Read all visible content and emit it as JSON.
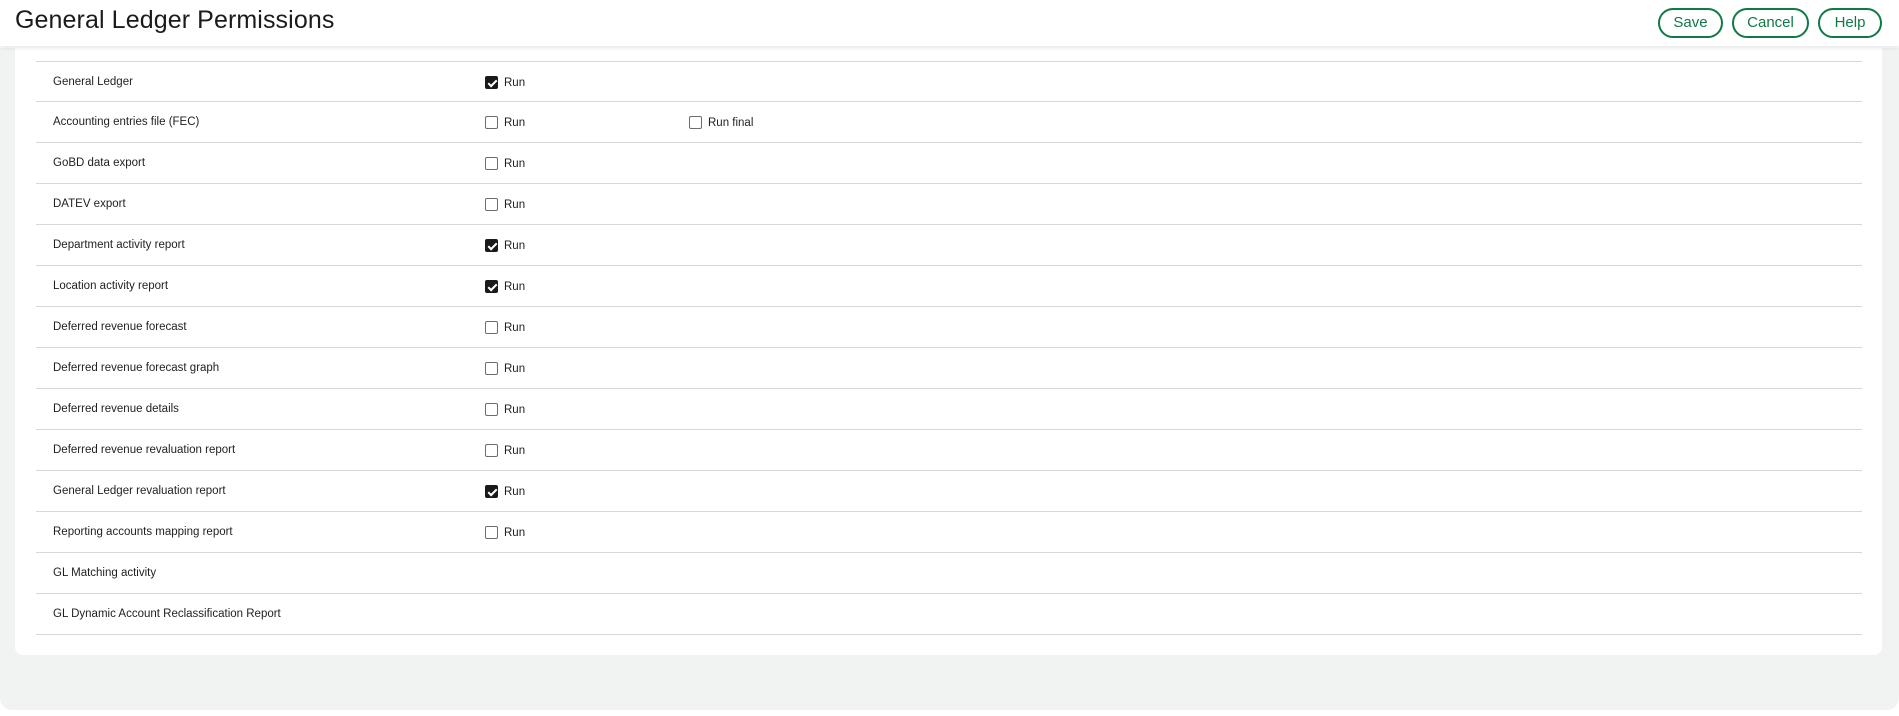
{
  "header": {
    "title": "General Ledger Permissions",
    "buttons": {
      "save": "Save",
      "cancel": "Cancel",
      "help": "Help"
    }
  },
  "colors": {
    "accent": "#0f7a46",
    "page_background": "#f1f3f3",
    "divider": "#d5d8d8"
  },
  "permissions": [
    {
      "label": "General Ledger",
      "options": [
        {
          "label": "Run",
          "checked": true
        }
      ]
    },
    {
      "label": "Accounting entries file (FEC)",
      "options": [
        {
          "label": "Run",
          "checked": false
        },
        {
          "label": "Run final",
          "checked": false
        }
      ]
    },
    {
      "label": "GoBD data export",
      "options": [
        {
          "label": "Run",
          "checked": false
        }
      ]
    },
    {
      "label": "DATEV export",
      "options": [
        {
          "label": "Run",
          "checked": false
        }
      ]
    },
    {
      "label": "Department activity report",
      "options": [
        {
          "label": "Run",
          "checked": true
        }
      ]
    },
    {
      "label": "Location activity report",
      "options": [
        {
          "label": "Run",
          "checked": true
        }
      ]
    },
    {
      "label": "Deferred revenue forecast",
      "options": [
        {
          "label": "Run",
          "checked": false
        }
      ]
    },
    {
      "label": "Deferred revenue forecast graph",
      "options": [
        {
          "label": "Run",
          "checked": false
        }
      ]
    },
    {
      "label": "Deferred revenue details",
      "options": [
        {
          "label": "Run",
          "checked": false
        }
      ]
    },
    {
      "label": "Deferred revenue revaluation report",
      "options": [
        {
          "label": "Run",
          "checked": false
        }
      ]
    },
    {
      "label": "General Ledger revaluation report",
      "options": [
        {
          "label": "Run",
          "checked": true
        }
      ]
    },
    {
      "label": "Reporting accounts mapping report",
      "options": [
        {
          "label": "Run",
          "checked": false
        }
      ]
    },
    {
      "label": "GL Matching activity",
      "options": []
    },
    {
      "label": "GL Dynamic Account Reclassification Report",
      "options": []
    }
  ]
}
